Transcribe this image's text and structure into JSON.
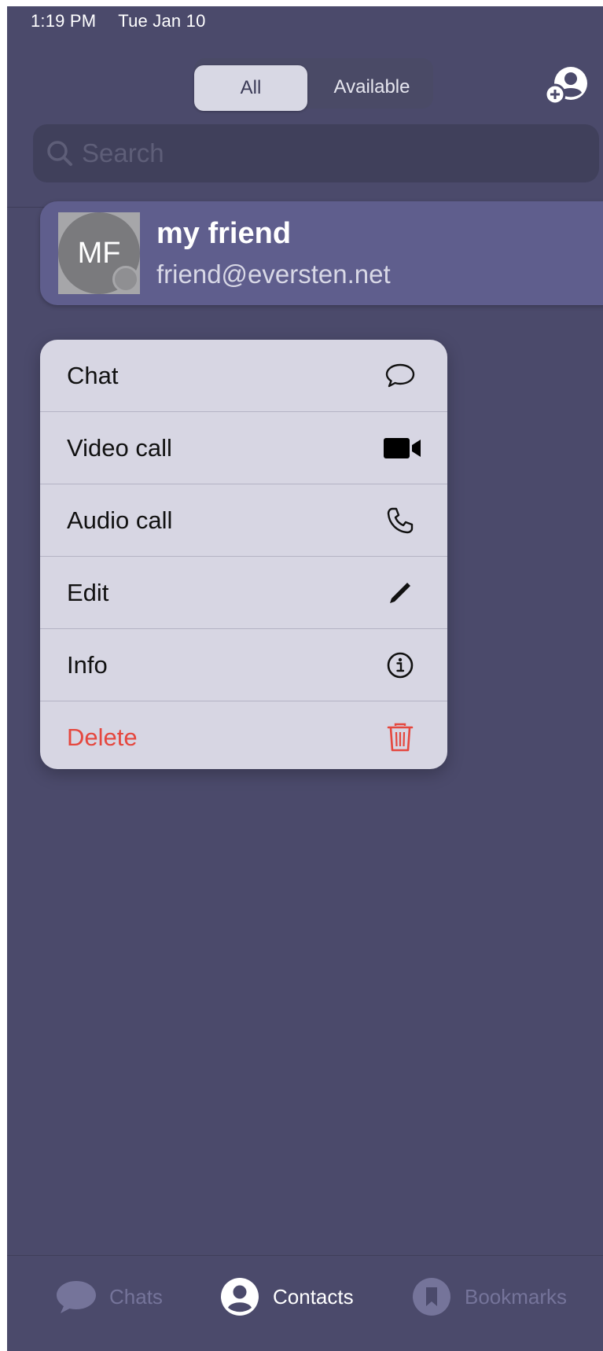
{
  "status_bar": {
    "time": "1:19 PM",
    "date": "Tue Jan 10"
  },
  "filter": {
    "all_label": "All",
    "available_label": "Available",
    "selected": "All"
  },
  "search": {
    "placeholder": "Search"
  },
  "contact": {
    "initials": "MF",
    "name": "my friend",
    "email": "friend@eversten.net"
  },
  "context_menu": {
    "items": [
      {
        "label": "Chat",
        "icon": "chat-bubble-icon"
      },
      {
        "label": "Video call",
        "icon": "video-camera-icon"
      },
      {
        "label": "Audio call",
        "icon": "phone-icon"
      },
      {
        "label": "Edit",
        "icon": "pencil-icon"
      },
      {
        "label": "Info",
        "icon": "info-icon"
      },
      {
        "label": "Delete",
        "icon": "trash-icon",
        "color": "#e5473e"
      }
    ]
  },
  "tab_bar": {
    "tabs": [
      {
        "label": "Chats",
        "icon": "chat-bubble-icon",
        "active": false
      },
      {
        "label": "Contacts",
        "icon": "person-circle-icon",
        "active": true
      },
      {
        "label": "Bookmarks",
        "icon": "bookmark-icon",
        "active": false
      }
    ]
  },
  "colors": {
    "background": "#4b4a6b",
    "card": "#5f5e8d",
    "menu": "#d7d6e3",
    "danger": "#e5473e",
    "inactive_tab": "#75749a"
  }
}
